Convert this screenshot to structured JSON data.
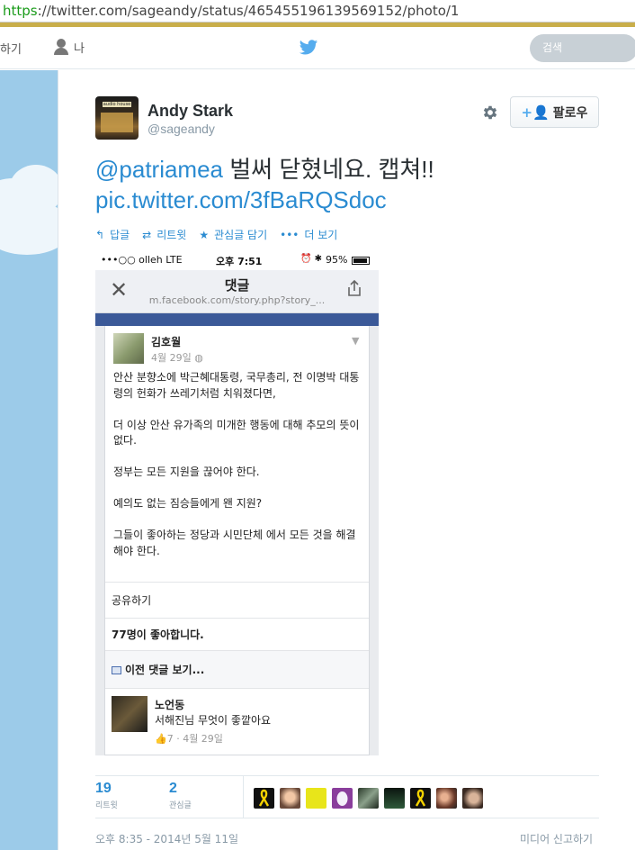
{
  "browser": {
    "url_scheme": "https",
    "url_rest": "://twitter.com/sageandy/status/465455196139569152/photo/1"
  },
  "nav": {
    "home_label_partial": "하기",
    "me_label": "나",
    "search_placeholder": "검색"
  },
  "tweet": {
    "author_name": "Andy Stark",
    "author_handle": "@sageandy",
    "avatar_sign_text": "audio house",
    "follow_label": "팔로우",
    "mention": "@patriamea",
    "text": "벌써 닫혔네요. 캡쳐!!",
    "link": "pic.twitter.com/3fBaRQSdoc",
    "actions": [
      {
        "icon": "reply-icon",
        "label": "답글"
      },
      {
        "icon": "retweet-icon",
        "label": "리트윗"
      },
      {
        "icon": "star-icon",
        "label": "관심글 담기"
      },
      {
        "icon": "more-icon",
        "label": "더 보기"
      }
    ],
    "stats": {
      "retweets": "19",
      "retweets_label": "리트윗",
      "favorites": "2",
      "favorites_label": "관심글"
    },
    "timestamp": "오후 8:35 - 2014년 5월 11일",
    "report_label": "미디어 신고하기"
  },
  "photo": {
    "status_left": "•••○○ olleh  LTE",
    "status_time": "오후 7:51",
    "status_battery": "95%",
    "header_title": "댓글",
    "header_url": "m.facebook.com/story.php?story_...",
    "post_author": "김호월",
    "post_date": "4월 29일",
    "paragraphs": [
      "안산 분향소에 박근혜대통령, 국무총리, 전 이명박 대통령의 헌화가 쓰레기처럼 치워졌다면,",
      "더 이상 안산 유가족의 미개한 행동에 대해 추모의 뜻이 없다.",
      "정부는 모든 지원을 끊어야 한다.",
      "예의도 없는 짐승들에게 왠 지원?",
      "그들이 좋아하는 정당과 시민단체 에서 모든 것을 해결해야 한다."
    ],
    "share_label": "공유하기",
    "likes_label": "77명이 좋아합니다.",
    "prev_comments_label": "이전 댓글 보기...",
    "comment_author": "노언동",
    "comment_text": "서해진님 무엇이 좋깥아요",
    "comment_meta": "7 · 4월 29일"
  },
  "colors": {
    "accent": "#2a8bd1",
    "background": "#9ccbe9",
    "facebook_blue": "#3b5998"
  }
}
